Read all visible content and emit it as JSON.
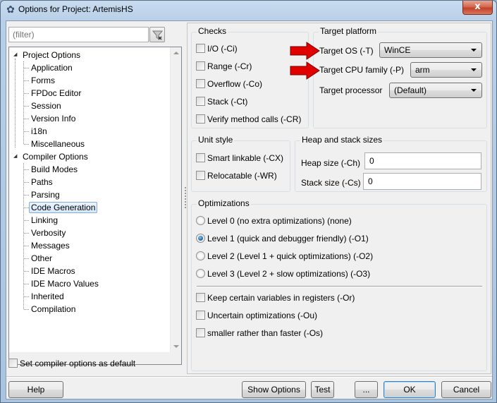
{
  "window": {
    "title": "Options for Project: ArtemisHS",
    "close_label": "x"
  },
  "filter": {
    "placeholder": "(filter)",
    "value": ""
  },
  "tree": {
    "groups": [
      {
        "label": "Project Options",
        "expanded": true,
        "items": [
          "Application",
          "Forms",
          "FPDoc Editor",
          "Session",
          "Version Info",
          "i18n",
          "Miscellaneous"
        ]
      },
      {
        "label": "Compiler Options",
        "expanded": true,
        "items": [
          "Build Modes",
          "Paths",
          "Parsing",
          "Code Generation",
          "Linking",
          "Verbosity",
          "Messages",
          "Other",
          "IDE Macros",
          "IDE Macro Values",
          "Inherited",
          "Compilation"
        ]
      }
    ],
    "selected": "Code Generation"
  },
  "default_checkbox": {
    "label": "Set compiler options as default",
    "checked": false
  },
  "checks": {
    "title": "Checks",
    "items": [
      {
        "label": "I/O (-Ci)",
        "checked": false
      },
      {
        "label": "Range (-Cr)",
        "checked": false
      },
      {
        "label": "Overflow (-Co)",
        "checked": false
      },
      {
        "label": "Stack (-Ct)",
        "checked": false
      },
      {
        "label": "Verify method calls (-CR)",
        "checked": false
      }
    ]
  },
  "target_platform": {
    "title": "Target platform",
    "os_label": "Target OS (-T)",
    "os_value": "WinCE",
    "cpu_label": "Target CPU family (-P)",
    "cpu_value": "arm",
    "processor_label": "Target processor",
    "processor_value": "(Default)",
    "annotation_color": "#e00000"
  },
  "unit_style": {
    "title": "Unit style",
    "items": [
      {
        "label": "Smart linkable (-CX)",
        "checked": false
      },
      {
        "label": "Relocatable (-WR)",
        "checked": false
      }
    ]
  },
  "heap_stack": {
    "title": "Heap and stack sizes",
    "heap_label": "Heap size (-Ch)",
    "heap_value": "0",
    "stack_label": "Stack size (-Cs)",
    "stack_value": "0"
  },
  "optimizations": {
    "title": "Optimizations",
    "levels": [
      {
        "label": "Level 0 (no extra optimizations) (none)",
        "selected": false
      },
      {
        "label": "Level 1 (quick and debugger friendly) (-O1)",
        "selected": true
      },
      {
        "label": "Level 2 (Level 1 + quick optimizations) (-O2)",
        "selected": false
      },
      {
        "label": "Level 3 (Level 2 + slow optimizations) (-O3)",
        "selected": false
      }
    ],
    "options": [
      {
        "label": "Keep certain variables in registers (-Or)",
        "checked": false
      },
      {
        "label": "Uncertain optimizations (-Ou)",
        "checked": false
      },
      {
        "label": "smaller rather than faster (-Os)",
        "checked": false
      }
    ]
  },
  "buttons": {
    "help": "Help",
    "show_options": "Show Options",
    "test": "Test",
    "more": "...",
    "ok": "OK",
    "cancel": "Cancel"
  }
}
